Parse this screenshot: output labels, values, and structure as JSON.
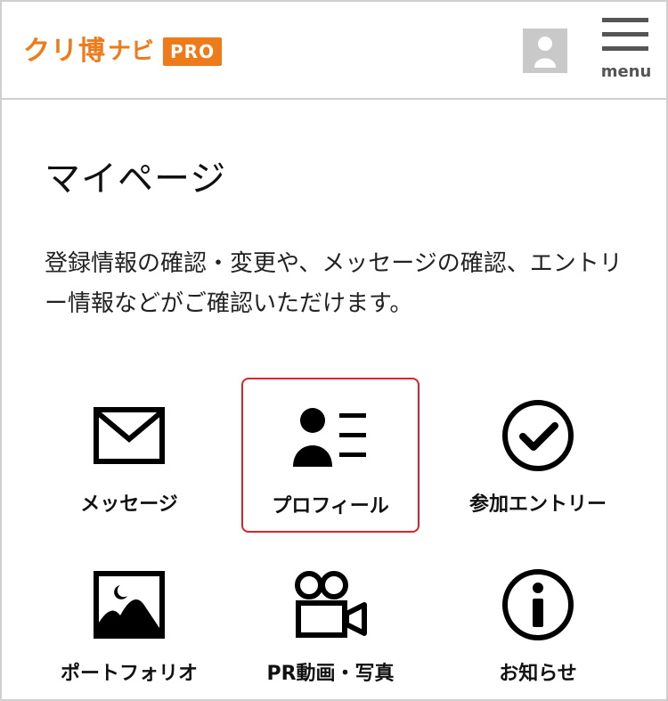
{
  "header": {
    "logo_main": "クリ博",
    "logo_sub": "ナビ",
    "logo_badge": "PRO",
    "menu_label": "menu"
  },
  "page": {
    "title": "マイページ",
    "description": "登録情報の確認・変更や、メッセージの確認、エントリー情報などがご確認いただけます。"
  },
  "tiles": [
    {
      "label": "メッセージ",
      "icon": "envelope-icon"
    },
    {
      "label": "プロフィール",
      "icon": "profile-card-icon",
      "selected": true
    },
    {
      "label": "参加エントリー",
      "icon": "check-circle-icon"
    },
    {
      "label": "ポートフォリオ",
      "icon": "landscape-image-icon"
    },
    {
      "label": "PR動画・写真",
      "icon": "video-camera-icon"
    },
    {
      "label": "お知らせ",
      "icon": "info-circle-icon"
    }
  ],
  "colors": {
    "brand": "#ee7a1a",
    "active_border": "#e0202a"
  }
}
